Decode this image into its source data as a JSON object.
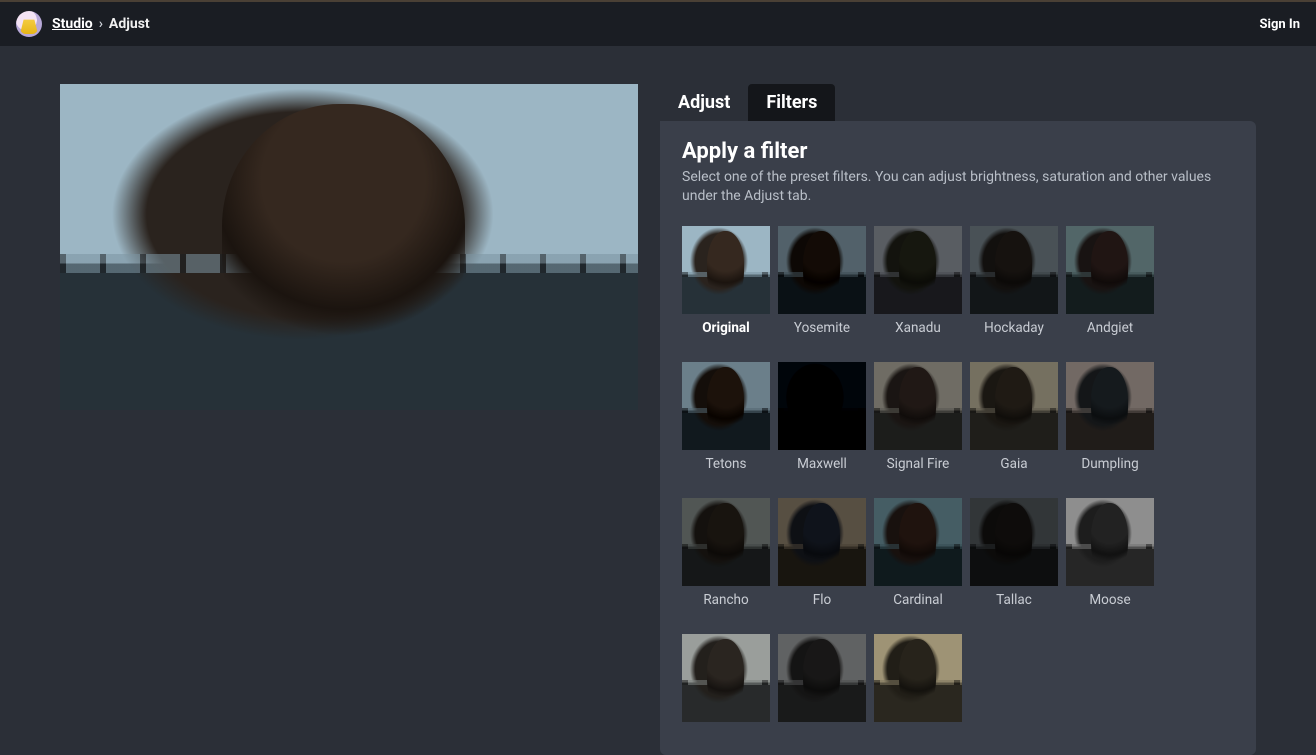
{
  "header": {
    "studio": "Studio",
    "separator": "›",
    "current": "Adjust",
    "signin": "Sign In"
  },
  "tabs": {
    "adjust": "Adjust",
    "filters": "Filters",
    "active": "filters"
  },
  "panel": {
    "title": "Apply a filter",
    "description": "Select one of the preset filters. You can adjust brightness, saturation and other values under the Adjust tab."
  },
  "filters": [
    {
      "key": "original",
      "label": "Original",
      "selected": true
    },
    {
      "key": "yosemite",
      "label": "Yosemite",
      "selected": false
    },
    {
      "key": "xanadu",
      "label": "Xanadu",
      "selected": false
    },
    {
      "key": "hockaday",
      "label": "Hockaday",
      "selected": false
    },
    {
      "key": "andgiet",
      "label": "Andgiet",
      "selected": false
    },
    {
      "key": "tetons",
      "label": "Tetons",
      "selected": false
    },
    {
      "key": "maxwell",
      "label": "Maxwell",
      "selected": false
    },
    {
      "key": "signalfire",
      "label": "Signal Fire",
      "selected": false
    },
    {
      "key": "gaia",
      "label": "Gaia",
      "selected": false
    },
    {
      "key": "dumpling",
      "label": "Dumpling",
      "selected": false
    },
    {
      "key": "rancho",
      "label": "Rancho",
      "selected": false
    },
    {
      "key": "flo",
      "label": "Flo",
      "selected": false
    },
    {
      "key": "cardinal",
      "label": "Cardinal",
      "selected": false
    },
    {
      "key": "tallac",
      "label": "Tallac",
      "selected": false
    },
    {
      "key": "moose",
      "label": "Moose",
      "selected": false
    },
    {
      "key": "extra1",
      "label": "",
      "selected": false
    },
    {
      "key": "extra2",
      "label": "",
      "selected": false
    },
    {
      "key": "extra3",
      "label": "",
      "selected": false
    }
  ]
}
